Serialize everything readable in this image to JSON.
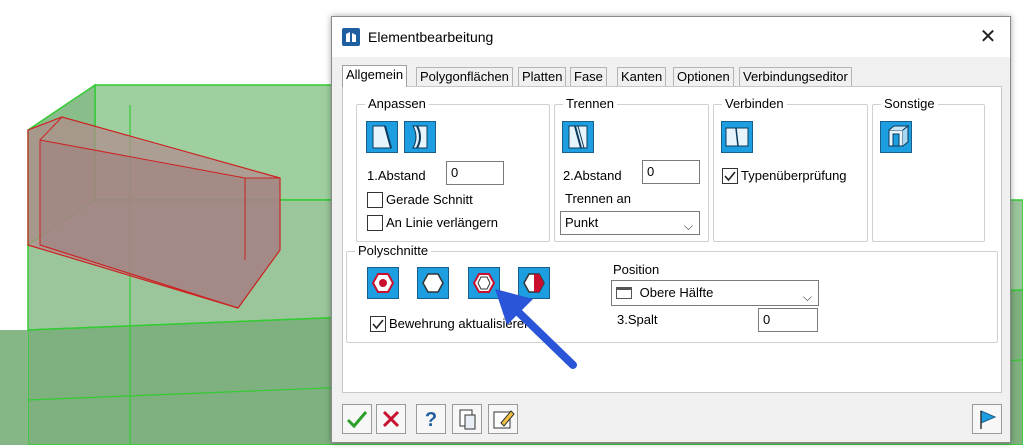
{
  "dialog": {
    "title": "Elementbearbeitung"
  },
  "tabs": [
    {
      "label": "Allgemein"
    },
    {
      "label": "Polygonflächen"
    },
    {
      "label": "Platten"
    },
    {
      "label": "Fase"
    },
    {
      "label": "Kanten"
    },
    {
      "label": "Optionen"
    },
    {
      "label": "Verbindungseditor"
    }
  ],
  "anpassen": {
    "title": "Anpassen",
    "abstand_label": "1.Abstand",
    "abstand_value": "0",
    "gerade_schnitt": {
      "label": "Gerade Schnitt",
      "checked": false
    },
    "an_linie": {
      "label": "An Linie verlängern",
      "checked": false
    }
  },
  "trennen": {
    "title": "Trennen",
    "abstand_label": "2.Abstand",
    "abstand_value": "0",
    "trennen_an_label": "Trennen an",
    "trennen_an_value": "Punkt"
  },
  "verbinden": {
    "title": "Verbinden",
    "typen": {
      "label": "Typenüberprüfung",
      "checked": true
    }
  },
  "sonstige": {
    "title": "Sonstige"
  },
  "polyschnitte": {
    "title": "Polyschnitte",
    "bewehrung": {
      "label": "Bewehrung aktualisieren",
      "checked": true
    },
    "position_label": "Position",
    "position_value": "Obere Hälfte",
    "spalt_label": "3.Spalt",
    "spalt_value": "0"
  },
  "colors": {
    "tool_blue": "#1d9ee0",
    "accent_red": "#c8102e",
    "arrow_blue": "#2a55d8",
    "model_green": "#3cd23c"
  }
}
